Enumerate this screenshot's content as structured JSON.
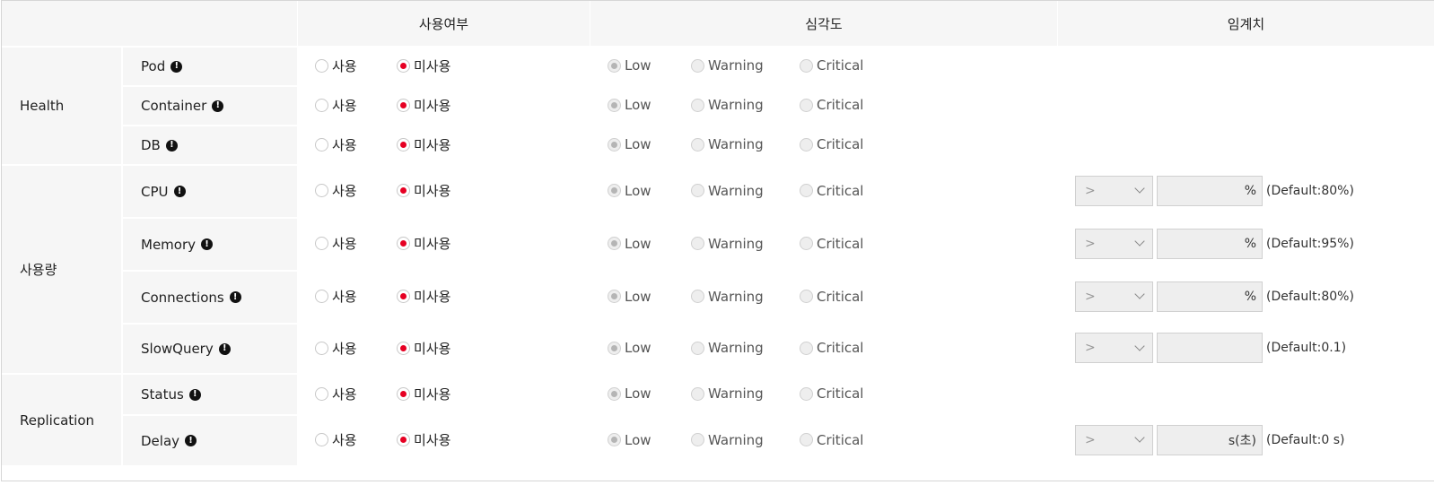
{
  "headers": {
    "usage": "사용여부",
    "severity": "심각도",
    "threshold": "임계치"
  },
  "groups": {
    "health": "Health",
    "usage": "사용량",
    "replication": "Replication"
  },
  "radio_labels": {
    "use": "사용",
    "nouse": "미사용",
    "low": "Low",
    "warning": "Warning",
    "critical": "Critical"
  },
  "info_icon": "!",
  "operator": ">",
  "rows": [
    {
      "label": "Pod",
      "usage": "미사용",
      "severity": "Low"
    },
    {
      "label": "Container",
      "usage": "미사용",
      "severity": "Low"
    },
    {
      "label": "DB",
      "usage": "미사용",
      "severity": "Low"
    },
    {
      "label": "CPU",
      "usage": "미사용",
      "severity": "Low",
      "unit": "%",
      "default": "(Default:80%)"
    },
    {
      "label": "Memory",
      "usage": "미사용",
      "severity": "Low",
      "unit": "%",
      "default": "(Default:95%)"
    },
    {
      "label": "Connections",
      "usage": "미사용",
      "severity": "Low",
      "unit": "%",
      "default": "(Default:80%)"
    },
    {
      "label": "SlowQuery",
      "usage": "미사용",
      "severity": "Low",
      "unit": "",
      "default": "(Default:0.1)"
    },
    {
      "label": "Status",
      "usage": "미사용",
      "severity": "Low"
    },
    {
      "label": "Delay",
      "usage": "미사용",
      "severity": "Low",
      "unit": "s(초)",
      "default": "(Default:0 s)"
    }
  ],
  "colors": {
    "accent": "#e60023",
    "header_bg": "#f6f6f6",
    "disabled_bg": "#eeeeee"
  }
}
